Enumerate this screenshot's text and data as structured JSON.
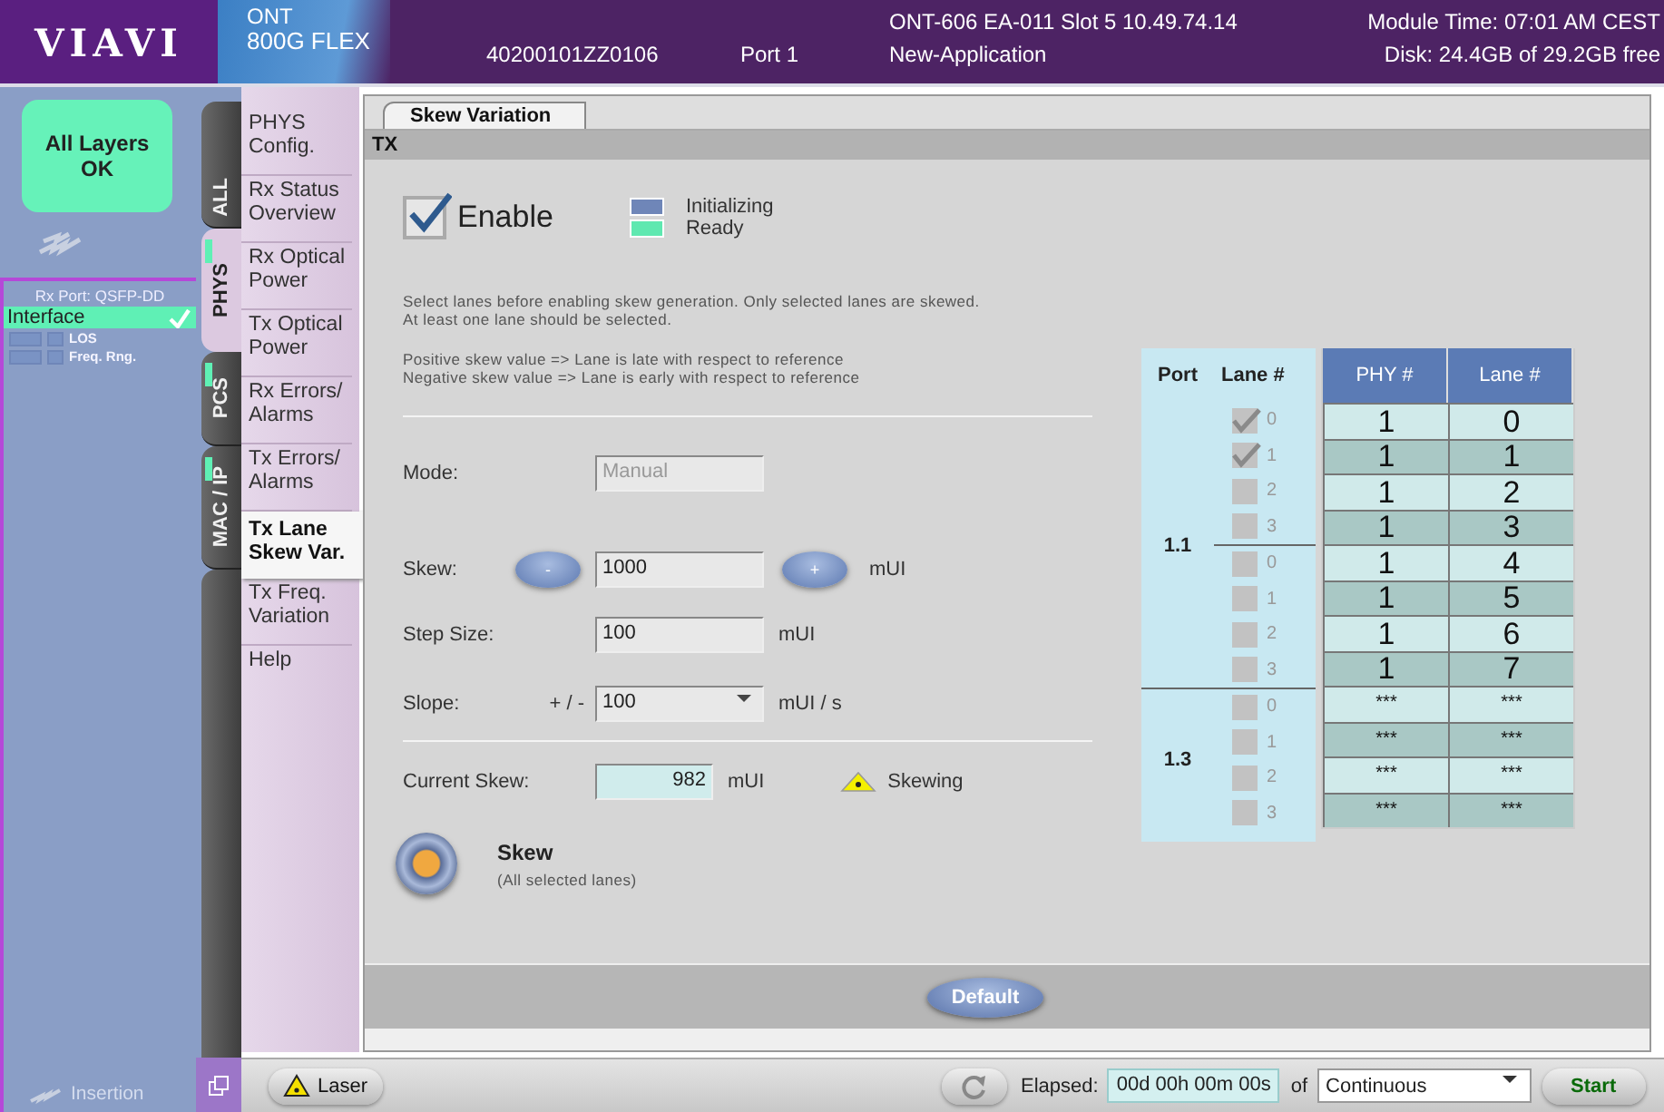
{
  "header": {
    "logo": "VIAVI",
    "product_line": "ONT",
    "product": "800G FLEX",
    "serial": "40200101ZZ0106",
    "port": "Port 1",
    "device": "ONT-606 EA-011 Slot 5  10.49.74.14",
    "application": "New-Application",
    "module_time": "Module Time: 07:01 AM CEST",
    "disk": "Disk: 24.4GB of 29.2GB free"
  },
  "status": {
    "text": "All Layers OK"
  },
  "rx_port": {
    "title": "Rx Port: QSFP-DD",
    "interface": {
      "label": "Interface",
      "ok": true
    },
    "indicators": [
      {
        "label": "LOS"
      },
      {
        "label": "Freq. Rng."
      }
    ],
    "insertion": "Insertion"
  },
  "layer_tabs": [
    {
      "label": "ALL",
      "selected": false,
      "indicator": false
    },
    {
      "label": "PHYS",
      "selected": true,
      "indicator": true
    },
    {
      "label": "PCS",
      "selected": false,
      "indicator": true
    },
    {
      "label": "MAC / IP",
      "selected": false,
      "indicator": true
    }
  ],
  "submenu": [
    {
      "label": "PHYS Config.",
      "selected": false
    },
    {
      "label": "Rx Status Overview",
      "selected": false
    },
    {
      "label": "Rx Optical Power",
      "selected": false
    },
    {
      "label": "Tx Optical Power",
      "selected": false
    },
    {
      "label": "Rx Errors/ Alarms",
      "selected": false
    },
    {
      "label": "Tx Errors/ Alarms",
      "selected": false
    },
    {
      "label": "Tx Lane Skew Var.",
      "selected": true
    },
    {
      "label": "Tx Freq. Variation",
      "selected": false
    },
    {
      "label": "Help",
      "selected": false
    }
  ],
  "panel": {
    "tab": "Skew Variation",
    "section": "TX",
    "enable": {
      "label": "Enable",
      "checked": true
    },
    "legend": [
      {
        "label": "Initializing",
        "color": "#6f86b8"
      },
      {
        "label": "Ready",
        "color": "#5fe8b0"
      }
    ],
    "notes": [
      "Select lanes before enabling skew generation. Only selected lanes are skewed.\nAt least one lane should be selected.",
      "Positive skew value => Lane is late with respect to reference\nNegative skew value => Lane is early with respect to reference"
    ],
    "mode": {
      "label": "Mode:",
      "value": "Manual",
      "disabled": true
    },
    "skew": {
      "label": "Skew:",
      "minus": "-",
      "value": "1000",
      "plus": "+",
      "unit": "mUI"
    },
    "step_size": {
      "label": "Step Size:",
      "value": "100",
      "unit": "mUI"
    },
    "slope": {
      "label": "Slope:",
      "prefix": "+ / -",
      "value": "100",
      "unit": "mUI / s"
    },
    "current_skew": {
      "label": "Current Skew:",
      "value": "982",
      "unit": "mUI",
      "status": "Skewing"
    },
    "skew_button": {
      "label": "Skew",
      "sublabel": "(All selected lanes)"
    },
    "default_button": "Default"
  },
  "lanes": {
    "columns": [
      "Port",
      "Lane #"
    ],
    "table_columns": [
      "PHY #",
      "Lane #"
    ],
    "ports": [
      {
        "port": "1.1",
        "blocks": [
          [
            {
              "lane": "0",
              "checked": true,
              "phy": "1",
              "lane_no": "0"
            },
            {
              "lane": "1",
              "checked": true,
              "phy": "1",
              "lane_no": "1"
            },
            {
              "lane": "2",
              "checked": false,
              "phy": "1",
              "lane_no": "2"
            },
            {
              "lane": "3",
              "checked": false,
              "phy": "1",
              "lane_no": "3"
            }
          ],
          [
            {
              "lane": "0",
              "checked": false,
              "phy": "1",
              "lane_no": "4"
            },
            {
              "lane": "1",
              "checked": false,
              "phy": "1",
              "lane_no": "5"
            },
            {
              "lane": "2",
              "checked": false,
              "phy": "1",
              "lane_no": "6"
            },
            {
              "lane": "3",
              "checked": false,
              "phy": "1",
              "lane_no": "7"
            }
          ]
        ]
      },
      {
        "port": "1.3",
        "blocks": [
          [
            {
              "lane": "0",
              "checked": false,
              "phy": "***",
              "lane_no": "***"
            },
            {
              "lane": "1",
              "checked": false,
              "phy": "***",
              "lane_no": "***"
            },
            {
              "lane": "2",
              "checked": false,
              "phy": "***",
              "lane_no": "***"
            },
            {
              "lane": "3",
              "checked": false,
              "phy": "***",
              "lane_no": "***"
            }
          ]
        ]
      }
    ]
  },
  "status_bar": {
    "laser": "Laser",
    "elapsed_label": "Elapsed:",
    "elapsed": "00d 00h 00m 00s",
    "of": "of",
    "duration": "Continuous",
    "start": "Start"
  }
}
